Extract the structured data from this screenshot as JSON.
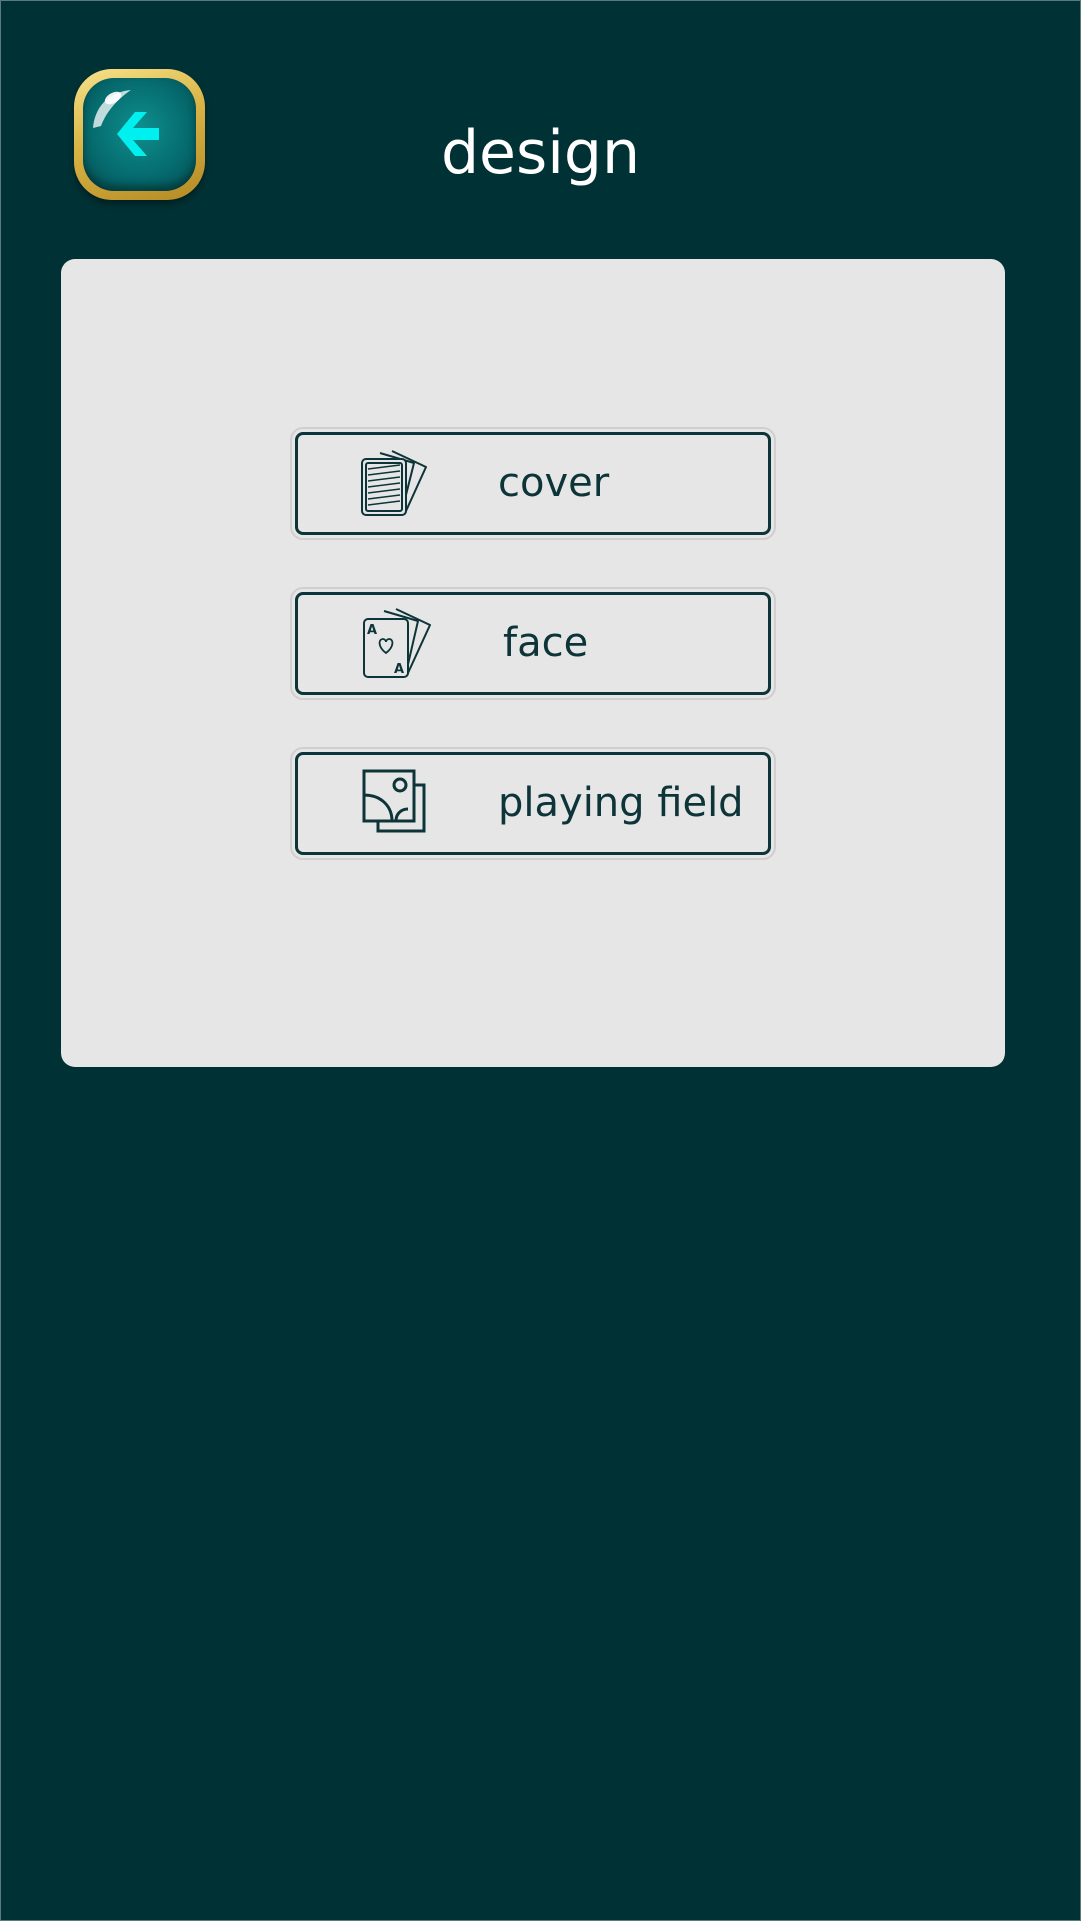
{
  "header": {
    "title": "design"
  },
  "back_button": {
    "icon": "arrow-left-icon"
  },
  "menu": {
    "items": [
      {
        "label": "cover",
        "icon": "card-back-stack-icon"
      },
      {
        "label": "face",
        "icon": "ace-of-hearts-stack-icon"
      },
      {
        "label": "playing field",
        "icon": "image-gallery-icon"
      }
    ]
  },
  "colors": {
    "background": "#003134",
    "panel": "#e6e6e6",
    "accent_dark": "#0d3438",
    "gold": "#d9b445",
    "teal_button": "#066d70",
    "arrow": "#00f0f0"
  }
}
